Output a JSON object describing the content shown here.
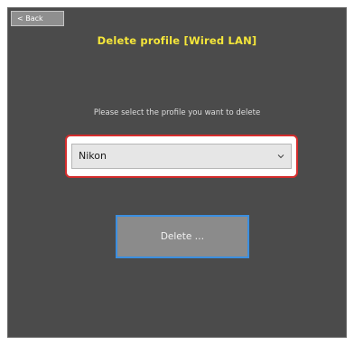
{
  "header": {
    "back_label": "< Back",
    "title": "Delete profile [Wired LAN]"
  },
  "main": {
    "prompt": "Please select the profile you want to delete",
    "profile_select": {
      "value": "Nikon",
      "icon": "chevron-down-icon"
    },
    "delete_label": "Delete …"
  },
  "colors": {
    "background": "#4b4b4b",
    "title": "#f5e63a",
    "highlight": "#d42c2c",
    "focus_border": "#3b8fe0"
  }
}
